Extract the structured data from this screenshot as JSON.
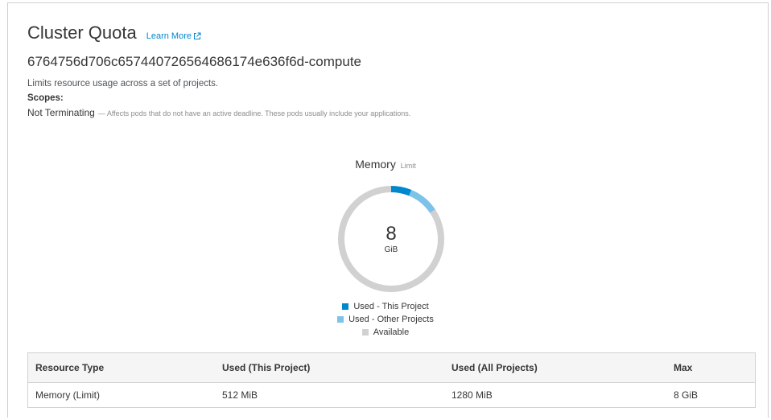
{
  "header": {
    "title": "Cluster Quota",
    "learn_more": "Learn More"
  },
  "quota": {
    "name": "6764756d706c657440726564686174e636f6d-compute",
    "description": "Limits resource usage across a set of projects.",
    "scopes_label": "Scopes:",
    "scope": {
      "name": "Not Terminating",
      "description": "— Affects pods that do not have an active deadline. These pods usually include your applications."
    }
  },
  "chart": {
    "title": "Memory",
    "subtitle": "Limit",
    "center_value": "8",
    "center_unit": "GiB",
    "legend": [
      {
        "label": "Used - This Project",
        "color": "#0088ce"
      },
      {
        "label": "Used - Other Projects",
        "color": "#7dc3e8"
      },
      {
        "label": "Available",
        "color": "#d1d1d1"
      }
    ]
  },
  "chart_data": {
    "type": "pie",
    "title": "Memory",
    "subtitle": "Limit",
    "unit": "MiB",
    "total": 8192,
    "slices": [
      {
        "label": "Used - This Project",
        "value": 512,
        "color": "#0088ce"
      },
      {
        "label": "Used - Other Projects",
        "value": 768,
        "color": "#7dc3e8"
      },
      {
        "label": "Available",
        "value": 6912,
        "color": "#d1d1d1"
      }
    ]
  },
  "table": {
    "headers": [
      "Resource Type",
      "Used (This Project)",
      "Used (All Projects)",
      "Max"
    ],
    "rows": [
      [
        "Memory (Limit)",
        "512 MiB",
        "1280 MiB",
        "8 GiB"
      ]
    ]
  }
}
